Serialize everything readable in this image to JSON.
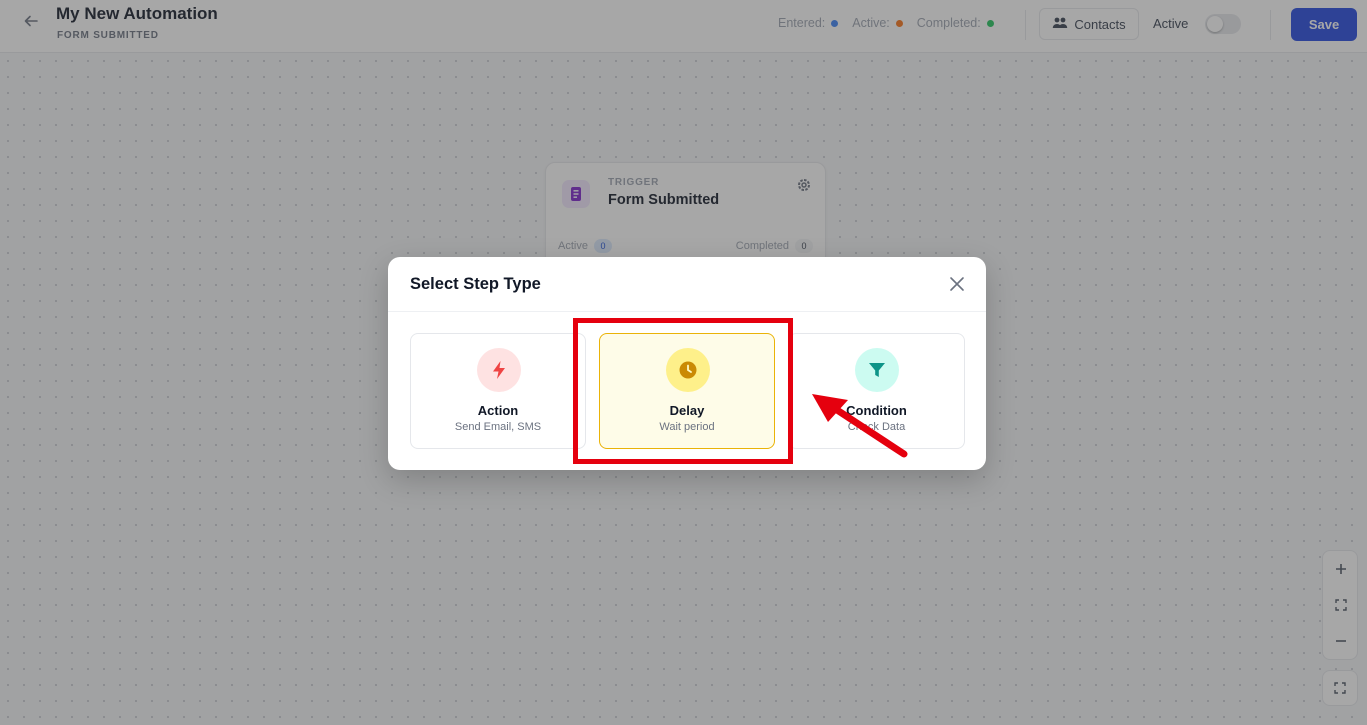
{
  "header": {
    "title": "My New Automation",
    "subtitle": "FORM SUBMITTED",
    "stats": [
      {
        "label": "Entered:",
        "color": "#3b82f6"
      },
      {
        "label": "Active:",
        "color": "#f97316"
      },
      {
        "label": "Completed:",
        "color": "#22c55e"
      }
    ],
    "contacts_label": "Contacts",
    "active_label": "Active",
    "active_toggle": false,
    "save_label": "Save"
  },
  "node": {
    "type_label": "TRIGGER",
    "title": "Form Submitted",
    "active_label": "Active",
    "active_count": "0",
    "completed_label": "Completed",
    "completed_count": "0"
  },
  "modal": {
    "title": "Select Step Type",
    "options": [
      {
        "label": "Action",
        "description": "Send Email, SMS",
        "icon": "bolt-icon",
        "color": "#ef4444"
      },
      {
        "label": "Delay",
        "description": "Wait period",
        "icon": "clock-icon",
        "color": "#ca8a04"
      },
      {
        "label": "Condition",
        "description": "Check Data",
        "icon": "filter-icon",
        "color": "#0d9488"
      }
    ]
  },
  "colors": {
    "accent": "#2348e0",
    "annotation": "#e5000e"
  }
}
